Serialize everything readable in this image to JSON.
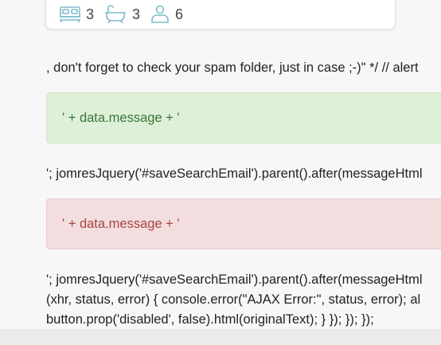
{
  "property_card": {
    "bedrooms": "3",
    "bathrooms": "3",
    "guests": "6",
    "icon_color": "#7fb8cf"
  },
  "content": {
    "line_spam": ", don't forget to check your spam folder, just in case ;-)\" */ // alert",
    "success_message": "' + data.message + '",
    "line_after_success": "'; jomresJquery('#saveSearchEmail').parent().after(messageHtml",
    "error_message": "' + data.message + '",
    "line_after_error_1": "'; jomresJquery('#saveSearchEmail').parent().after(messageHtml",
    "line_after_error_2": "(xhr, status, error) { console.error(\"AJAX Error:\", status, error); al",
    "line_after_error_3": "button.prop('disabled', false).html(originalText); } }); }); });"
  },
  "colors": {
    "success_bg": "#dff0d8",
    "success_text": "#3c763d",
    "danger_bg": "#f2dede",
    "danger_text": "#a94442"
  }
}
